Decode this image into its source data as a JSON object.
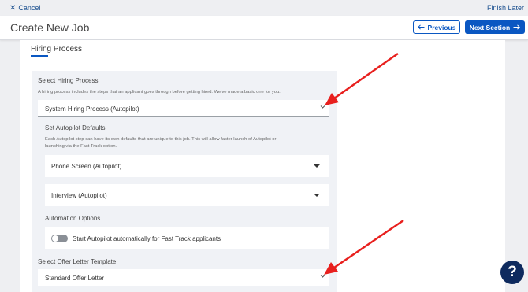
{
  "topbar": {
    "cancel_label": "Cancel",
    "finish_label": "Finish Later"
  },
  "header": {
    "title": "Create New Job",
    "previous_label": "Previous",
    "next_label": "Next Section"
  },
  "section": {
    "title": "Hiring Process"
  },
  "hiring_process": {
    "label": "Select Hiring Process",
    "help": "A hiring process includes the steps that an applicant goes through before getting hired. We've made a basic one for you.",
    "selected": "System Hiring Process (Autopilot)"
  },
  "autopilot_defaults": {
    "label": "Set Autopilot Defaults",
    "help_line1": "Each Autopilot step can have its own defaults that are unique to this job. This will allow faster launch of Autopilot or",
    "help_line2": "launching via the Fast Track option.",
    "phone_screen": "Phone Screen (Autopilot)",
    "interview": "Interview (Autopilot)"
  },
  "automation": {
    "label": "Automation Options",
    "toggle_label": "Start Autopilot automatically for Fast Track applicants",
    "toggle_on": false
  },
  "offer_letter": {
    "label": "Select Offer Letter Template",
    "selected": "Standard Offer Letter"
  },
  "help_button": {
    "label": "?"
  },
  "colors": {
    "primary": "#0a57c2",
    "annotation_arrow": "#e8201e",
    "help_fab": "#0e2a5e"
  }
}
